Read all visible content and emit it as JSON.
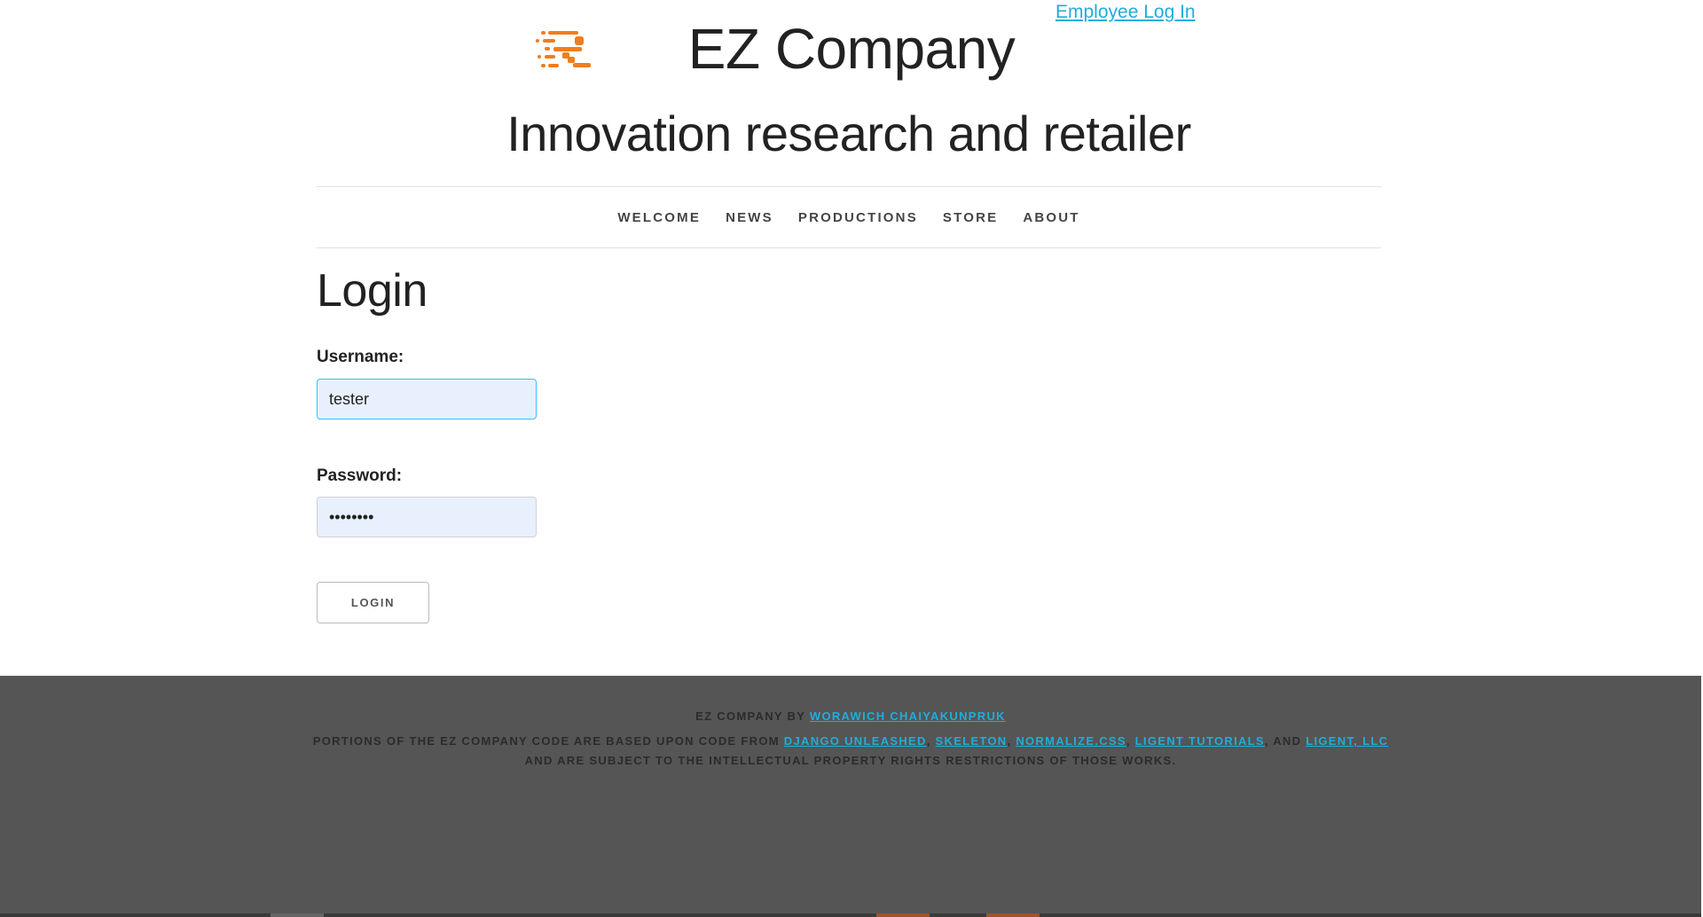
{
  "header": {
    "employee_login": "Employee Log In",
    "logo_icon": "ez-company-logo-icon",
    "title": "EZ Company",
    "tagline": "Innovation research and retailer"
  },
  "nav": {
    "items": [
      {
        "label": "WELCOME"
      },
      {
        "label": "NEWS"
      },
      {
        "label": "PRODUCTIONS"
      },
      {
        "label": "STORE"
      },
      {
        "label": "ABOUT"
      }
    ]
  },
  "login": {
    "heading": "Login",
    "username_label": "Username:",
    "username_value": "tester",
    "password_label": "Password:",
    "password_value": "••••••••",
    "button_label": "LOGIN"
  },
  "footer": {
    "line1_prefix": "EZ COMPANY BY ",
    "author_link": "WORAWICH CHAIYAKUNPRUK",
    "line2_prefix": "PORTIONS OF THE EZ COMPANY CODE ARE BASED UPON CODE FROM ",
    "link_django": "DJANGO UNLEASHED",
    "sep1": ", ",
    "link_skeleton": "SKELETON",
    "sep2": ", ",
    "link_normalize": "NORMALIZE.CSS",
    "sep3": ", ",
    "link_ligent_tutorials": "LIGENT TUTORIALS",
    "sep4": ", AND ",
    "link_ligent_llc": "LIGENT, LLC",
    "line3": "AND ARE SUBJECT TO THE INTELLECTUAL PROPERTY RIGHTS RESTRICTIONS OF THOSE WORKS."
  },
  "colors": {
    "link": "#1EAEDB",
    "logo_orange": "#F07D1E",
    "footer_bg": "#555555",
    "input_bg": "#e8f0fe",
    "input_focus_border": "#33C3F0"
  }
}
